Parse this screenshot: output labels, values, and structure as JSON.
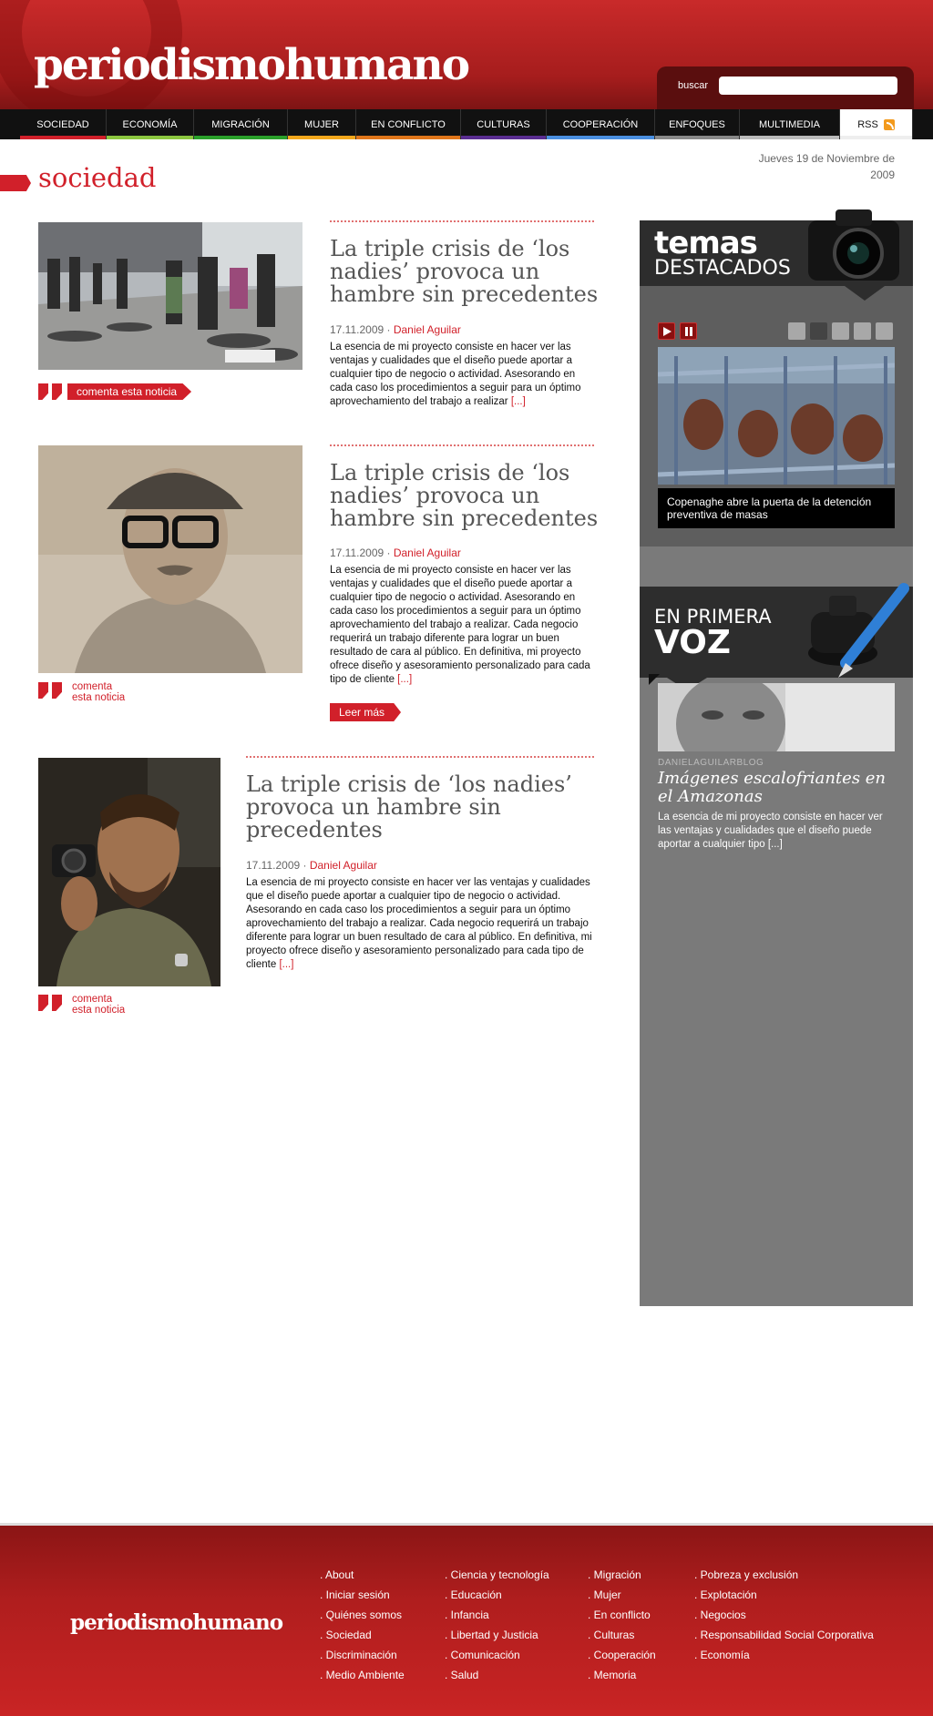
{
  "header": {
    "logo": "periodismohumano",
    "search_label": "buscar",
    "search_placeholder": ""
  },
  "nav": [
    {
      "label": "SOCIEDAD",
      "color": "#d1202a"
    },
    {
      "label": "ECONOMÍA",
      "color": "#8cc63f"
    },
    {
      "label": "MIGRACIÓN",
      "color": "#2aa02a"
    },
    {
      "label": "MUJER",
      "color": "#f2a71b"
    },
    {
      "label": "EN CONFLICTO",
      "color": "#e0761a"
    },
    {
      "label": "CULTURAS",
      "color": "#5a2d91"
    },
    {
      "label": "COOPERACIÓN",
      "color": "#4a8fe0"
    },
    {
      "label": "ENFOQUES",
      "color": "#888888"
    },
    {
      "label": "MULTIMEDIA",
      "color": "#bbbbbb"
    },
    {
      "label": "RSS",
      "color": "#eeeeee"
    }
  ],
  "section": {
    "title": "sociedad",
    "date": "Jueves 19 de Noviembre de 2009"
  },
  "articles": [
    {
      "title": "La triple crisis de ‘los nadies’ provoca un hambre sin precedentes",
      "date": "17.11.2009 · ",
      "author": "Daniel Aguilar",
      "body": "La esencia de mi proyecto consiste en hacer ver las ventajas y cualidades que el diseño puede aportar a cualquier tipo de negocio o  actividad. Asesorando en cada caso los procedimientos a seguir para un óptimo aprovechamiento del trabajo a realizar ",
      "more": "[...]",
      "comment": "comenta esta noticia"
    },
    {
      "title": "La triple crisis de ‘los nadies’ provoca un hambre sin precedentes",
      "date": "17.11.2009 · ",
      "author": "Daniel Aguilar",
      "body": "La esencia de mi proyecto consiste en hacer ver las ventajas y cualidades que el diseño puede aportar a cualquier tipo de negocio o  actividad. Asesorando en cada caso los procedimientos a seguir para un óptimo aprovechamiento del trabajo a realizar. Cada negocio requerirá un trabajo diferente para lograr un buen resultado de cara al público. En definitiva, mi proyecto ofrece diseño y asesoramiento personalizado para cada tipo de cliente ",
      "more": "[...]",
      "comment_line1": "comenta",
      "comment_line2": "esta noticia",
      "read_more": "Leer más"
    },
    {
      "title": "La triple crisis de ‘los nadies’ provoca un hambre sin precedentes",
      "date": "17.11.2009 · ",
      "author": "Daniel Aguilar",
      "body": "La esencia de mi proyecto consiste en hacer ver las ventajas y cualidades que el diseño puede aportar a cualquier tipo de negocio o actividad. Asesorando en cada caso los procedimientos a seguir para un óptimo aprovechamiento del trabajo a realizar. Cada negocio requerirá un trabajo diferente para lograr un buen resultado de cara al público. En definitiva, mi proyecto ofrece diseño y asesoramiento personalizado para cada tipo de cliente ",
      "more": "[...]",
      "comment_line1": "comenta",
      "comment_line2": "esta noticia"
    }
  ],
  "sidebar": {
    "temas": {
      "heading1": "temas",
      "heading2": "DESTACADOS",
      "caption": "Copenaghe abre la puerta de la detención preventiva de masas",
      "active_slide": 2,
      "slide_count": 5
    },
    "voz": {
      "heading1": "EN PRIMERA",
      "heading2": "VOZ",
      "blog": "DANIELAGUILARBLOG",
      "title": "Imágenes escalofriantes en el Amazonas",
      "body": "La esencia de mi proyecto consiste en hacer ver las ventajas y cualidades que el diseño puede aportar a cualquier tipo [...]"
    }
  },
  "footer": {
    "logo": "periodismohumano",
    "col1": [
      ". About",
      ". Iniciar sesión",
      ". Quiénes somos",
      ". Sociedad",
      ". Discriminación",
      ". Medio Ambiente"
    ],
    "col2": [
      ". Ciencia y tecnología",
      ". Educación",
      ". Infancia",
      ". Libertad y Justicia",
      ". Comunicación",
      ". Salud"
    ],
    "col3": [
      ". Migración",
      ". Mujer",
      ". En conflicto",
      ". Culturas",
      ". Cooperación",
      ". Memoria"
    ],
    "col4": [
      ". Pobreza y exclusión",
      ". Explotación",
      ". Negocios",
      ". Responsabilidad Social Corporativa",
      ". Economía"
    ]
  }
}
